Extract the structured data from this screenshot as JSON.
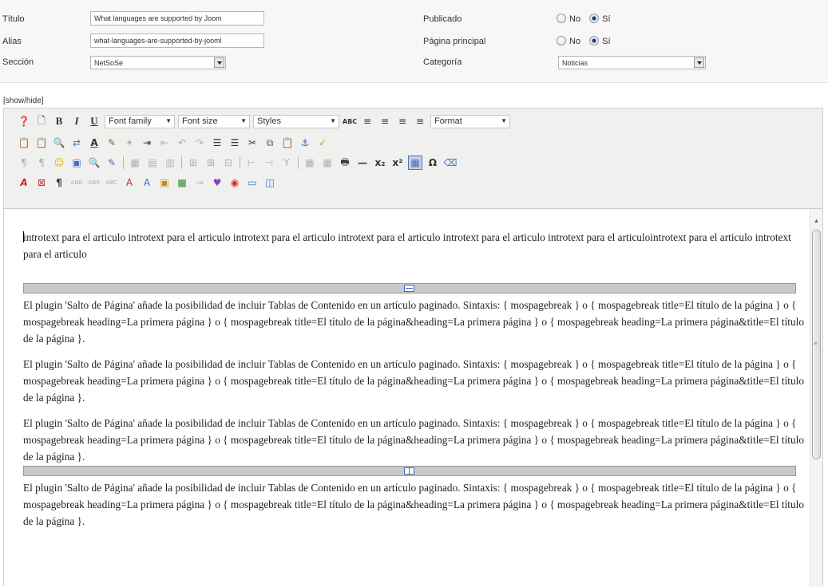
{
  "form": {
    "title_label": "Título",
    "title_value": "What languages are supported by Joom",
    "alias_label": "Alias",
    "alias_value": "what-languages-are-supported-by-jooml",
    "section_label": "Sección",
    "section_value": "NetSoSe",
    "published_label": "Publicado",
    "frontpage_label": "Página principal",
    "category_label": "Categoría",
    "category_value": "Noticias",
    "no_label": "No",
    "yes_label": "Sí",
    "published_value": "Sí",
    "frontpage_value": "Sí"
  },
  "editor": {
    "showhide": "[show/hide]",
    "font_family": "Font family",
    "font_size": "Font size",
    "styles": "Styles",
    "format": "Format"
  },
  "content": {
    "intro": "introtext para el articulo introtext para el articulo introtext para el articulo introtext para el articulo introtext para el articulo introtext para el articulointrotext para el articulo introtext para el articulo",
    "paragraph": "El plugin 'Salto de Página' añade la posibilidad de incluir Tablas de Contenido en un artículo paginado. Sintaxis: { mospagebreak } o { mospagebreak title=El título de la página } o { mospagebreak heading=La primera página } o { mospagebreak title=El título de la página&heading=La primera página } o { mospagebreak heading=La primera página&title=El título de la página }."
  },
  "icons": {
    "toolbar_row1": [
      "help-icon",
      "new-document-icon",
      "bold-icon",
      "italic-icon",
      "underline-icon",
      "spellcheck-icon",
      "align-left-icon",
      "align-center-icon",
      "align-right-icon",
      "align-justify-icon"
    ],
    "toolbar_row2": [
      "paste-text-icon",
      "paste-word-icon",
      "search-icon",
      "replace-icon",
      "font-color-icon",
      "highlight-icon",
      "clean-icon",
      "indent-icon",
      "outdent-icon",
      "undo-icon",
      "redo-icon",
      "bullet-list-icon",
      "numbered-list-icon",
      "cut-icon",
      "copy-icon",
      "paste-icon",
      "anchor-icon",
      "cleanup-icon"
    ],
    "toolbar_row3": [
      "ltr-icon",
      "rtl-icon",
      "emoticon-icon",
      "image-icon",
      "preview-icon",
      "insert-edit-icon",
      "table-icon",
      "row-props-icon",
      "cell-props-icon",
      "insert-row-before-icon",
      "insert-row-after-icon",
      "delete-row-icon",
      "split-cells-icon",
      "merge-cells-icon",
      "visual-aid-icon",
      "media-icon",
      "print-icon",
      "horizontal-rule-icon",
      "subscript-icon",
      "superscript-icon",
      "fullscreen-icon",
      "special-char-icon",
      "remove-format-icon"
    ],
    "toolbar_row4": [
      "style-icon",
      "abbr-icon",
      "pilcrow-icon",
      "cite-icon",
      "acronym-icon",
      "del-icon",
      "ins-icon",
      "attributes-icon",
      "template-icon",
      "layer-icon",
      "nonbreaking-icon",
      "readmore-icon",
      "pagebreak-icon"
    ]
  },
  "colors": {
    "accent": "#3c6fc4",
    "toolbar_bg": "#f0f0ee",
    "pagebreak_bar": "#c9c9c9"
  }
}
